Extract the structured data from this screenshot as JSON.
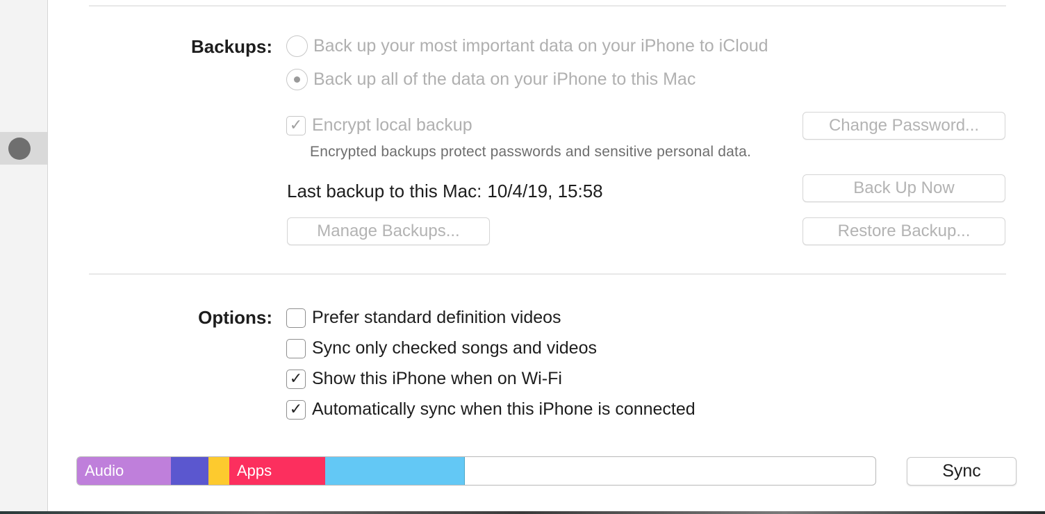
{
  "backups": {
    "label": "Backups:",
    "radio_icloud": {
      "label": "Back up your most important data on your iPhone to iCloud",
      "selected": false
    },
    "radio_mac": {
      "label": "Back up all of the data on your iPhone to this Mac",
      "selected": true
    },
    "encrypt": {
      "label": "Encrypt local backup",
      "checked": true,
      "check_glyph": "✓"
    },
    "encrypt_description": "Encrypted backups protect passwords and sensitive personal data.",
    "last_backup_label": "Last backup to this Mac:",
    "last_backup_value": "10/4/19, 15:58",
    "change_password_button": "Change Password...",
    "back_up_now_button": "Back Up Now",
    "manage_backups_button": "Manage Backups...",
    "restore_backup_button": "Restore Backup..."
  },
  "options": {
    "label": "Options:",
    "items": [
      {
        "label": "Prefer standard definition videos",
        "checked": false,
        "glyph": ""
      },
      {
        "label": "Sync only checked songs and videos",
        "checked": false,
        "glyph": ""
      },
      {
        "label": "Show this iPhone when on Wi-Fi",
        "checked": true,
        "glyph": "✓"
      },
      {
        "label": "Automatically sync when this iPhone is connected",
        "checked": true,
        "glyph": "✓"
      }
    ]
  },
  "storage": {
    "segments": [
      {
        "label": "Audio",
        "color": "#bf7fdb"
      },
      {
        "label": "",
        "color": "#5b57cf"
      },
      {
        "label": "",
        "color": "#fdca2e"
      },
      {
        "label": "Apps",
        "color": "#fc2f5e"
      },
      {
        "label": "",
        "color": "#63c8f5"
      }
    ],
    "free_color": "#ffffff"
  },
  "sync_button": "Sync",
  "sidebar": {
    "selected_icon": "device-icon"
  }
}
